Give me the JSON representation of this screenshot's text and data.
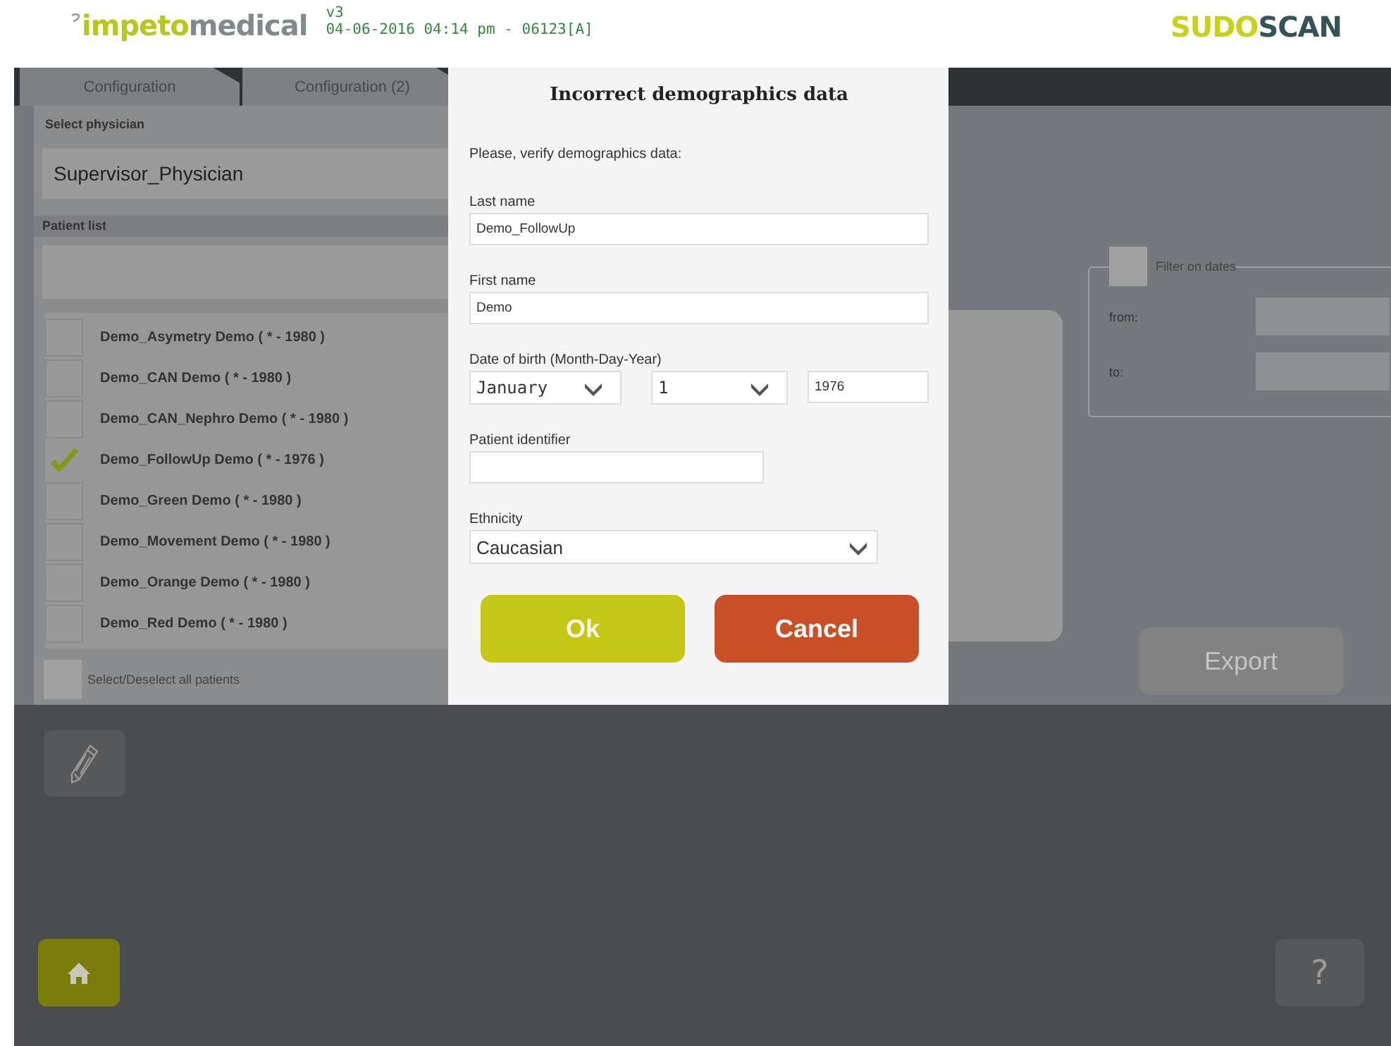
{
  "header": {
    "brand_primary": "impeto",
    "brand_secondary": "medical",
    "version": "v3",
    "timestamp": "04-06-2016 04:14 pm - 06123[A]",
    "product_primary": "SUDO",
    "product_secondary": "SCAN"
  },
  "tabs": [
    {
      "label": "Configuration",
      "selected": false
    },
    {
      "label": "Configuration (2)",
      "selected": false
    }
  ],
  "physician": {
    "label": "Select physician",
    "value": "Supervisor_Physician"
  },
  "patient_list": {
    "label": "Patient list",
    "patients": [
      {
        "name": "Demo_Asymetry Demo ( * - 1980 )",
        "checked": false
      },
      {
        "name": "Demo_CAN Demo ( * - 1980 )",
        "checked": false
      },
      {
        "name": "Demo_CAN_Nephro Demo ( * - 1980 )",
        "checked": false
      },
      {
        "name": "Demo_FollowUp Demo ( * - 1976 )",
        "checked": true
      },
      {
        "name": "Demo_Green Demo ( * - 1980 )",
        "checked": false
      },
      {
        "name": "Demo_Movement Demo ( * - 1980 )",
        "checked": false
      },
      {
        "name": "Demo_Orange Demo ( * - 1980 )",
        "checked": false
      },
      {
        "name": "Demo_Red Demo ( * - 1980 )",
        "checked": false
      }
    ],
    "select_all": {
      "label": "Select/Deselect all patients",
      "checked": false
    }
  },
  "filter": {
    "label": "Filter on dates",
    "checked": false,
    "from_label": "from:",
    "to_label": "to:"
  },
  "export": {
    "label": "Export",
    "disabled": true
  },
  "help": {
    "label": "?"
  },
  "dialog": {
    "title": "Incorrect demographics data",
    "message": "Please, verify demographics data:",
    "fields": [
      {
        "kind": "text",
        "label": "Last name",
        "value": "Demo_FollowUp"
      },
      {
        "kind": "text",
        "label": "First name",
        "value": "Demo"
      },
      {
        "kind": "date",
        "label": "Date of birth (Month-Day-Year)",
        "parts": [
          {
            "kind": "select",
            "value": "January"
          },
          {
            "kind": "select",
            "value": "1"
          },
          {
            "kind": "text",
            "value": "1976"
          }
        ]
      },
      {
        "kind": "short",
        "label": "Patient identifier"
      },
      {
        "kind": "select",
        "label": "Ethnicity",
        "value": "Caucasian"
      }
    ],
    "buttons": [
      {
        "label": "Ok",
        "kind": "confirm"
      },
      {
        "label": "Cancel",
        "kind": "cancel"
      }
    ]
  }
}
